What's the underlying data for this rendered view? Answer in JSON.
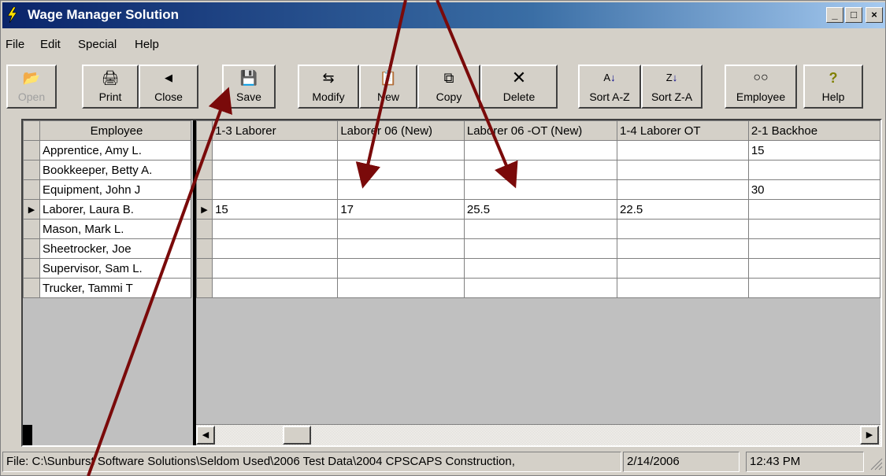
{
  "window": {
    "title": "Wage Manager Solution",
    "min": "_",
    "max": "□",
    "close": "×"
  },
  "menu": [
    "File",
    "Edit",
    "Special",
    "Help"
  ],
  "toolbar": {
    "open": "Open",
    "print": "Print",
    "close": "Close",
    "save": "Save",
    "modify": "Modify",
    "new": "New",
    "copy": "Copy",
    "delete": "Delete",
    "sort_az": "Sort A-Z",
    "sort_za": "Sort Z-A",
    "employee": "Employee",
    "help": "Help"
  },
  "grid": {
    "employee_header": "Employee",
    "columns": [
      "1-3 Laborer",
      "Laborer 06 (New)",
      "Laborer 06 -OT (New)",
      "1-4 Laborer OT",
      "2-1 Backhoe"
    ],
    "rows": [
      {
        "name": "Apprentice, Amy L.",
        "cells": [
          "",
          "",
          "",
          "",
          "15"
        ]
      },
      {
        "name": "Bookkeeper, Betty A.",
        "cells": [
          "",
          "",
          "",
          "",
          ""
        ]
      },
      {
        "name": "Equipment, John J",
        "cells": [
          "",
          "",
          "",
          "",
          "30"
        ]
      },
      {
        "name": "Laborer, Laura B.",
        "cells": [
          "15",
          "17",
          "25.5",
          "22.5",
          ""
        ],
        "current": true
      },
      {
        "name": "Mason, Mark L.",
        "cells": [
          "",
          "",
          "",
          "",
          ""
        ]
      },
      {
        "name": "Sheetrocker, Joe",
        "cells": [
          "",
          "",
          "",
          "",
          ""
        ]
      },
      {
        "name": "Supervisor, Sam L.",
        "cells": [
          "",
          "",
          "",
          "",
          ""
        ]
      },
      {
        "name": "Trucker, Tammi T",
        "cells": [
          "",
          "",
          "",
          "",
          ""
        ]
      }
    ],
    "current_row_marker": "▶"
  },
  "status": {
    "file": "File: C:\\Sunburst Software Solutions\\Seldom Used\\2006 Test Data\\2004 CPSCAPS Construction,",
    "date": "2/14/2006",
    "time": "12:43 PM"
  },
  "colors": {
    "title_bar": "#0a246a",
    "annotation_arrow": "#7a0a0a",
    "face": "#d4d0c8"
  },
  "icons": [
    "app-lightning-icon",
    "folder-open-icon",
    "printer-icon",
    "arrow-left-icon",
    "floppy-disk-icon",
    "modify-icon",
    "clipboard-new-icon",
    "copy-icon",
    "delete-x-icon",
    "sort-az-icon",
    "sort-za-icon",
    "binoculars-icon",
    "help-question-icon"
  ]
}
